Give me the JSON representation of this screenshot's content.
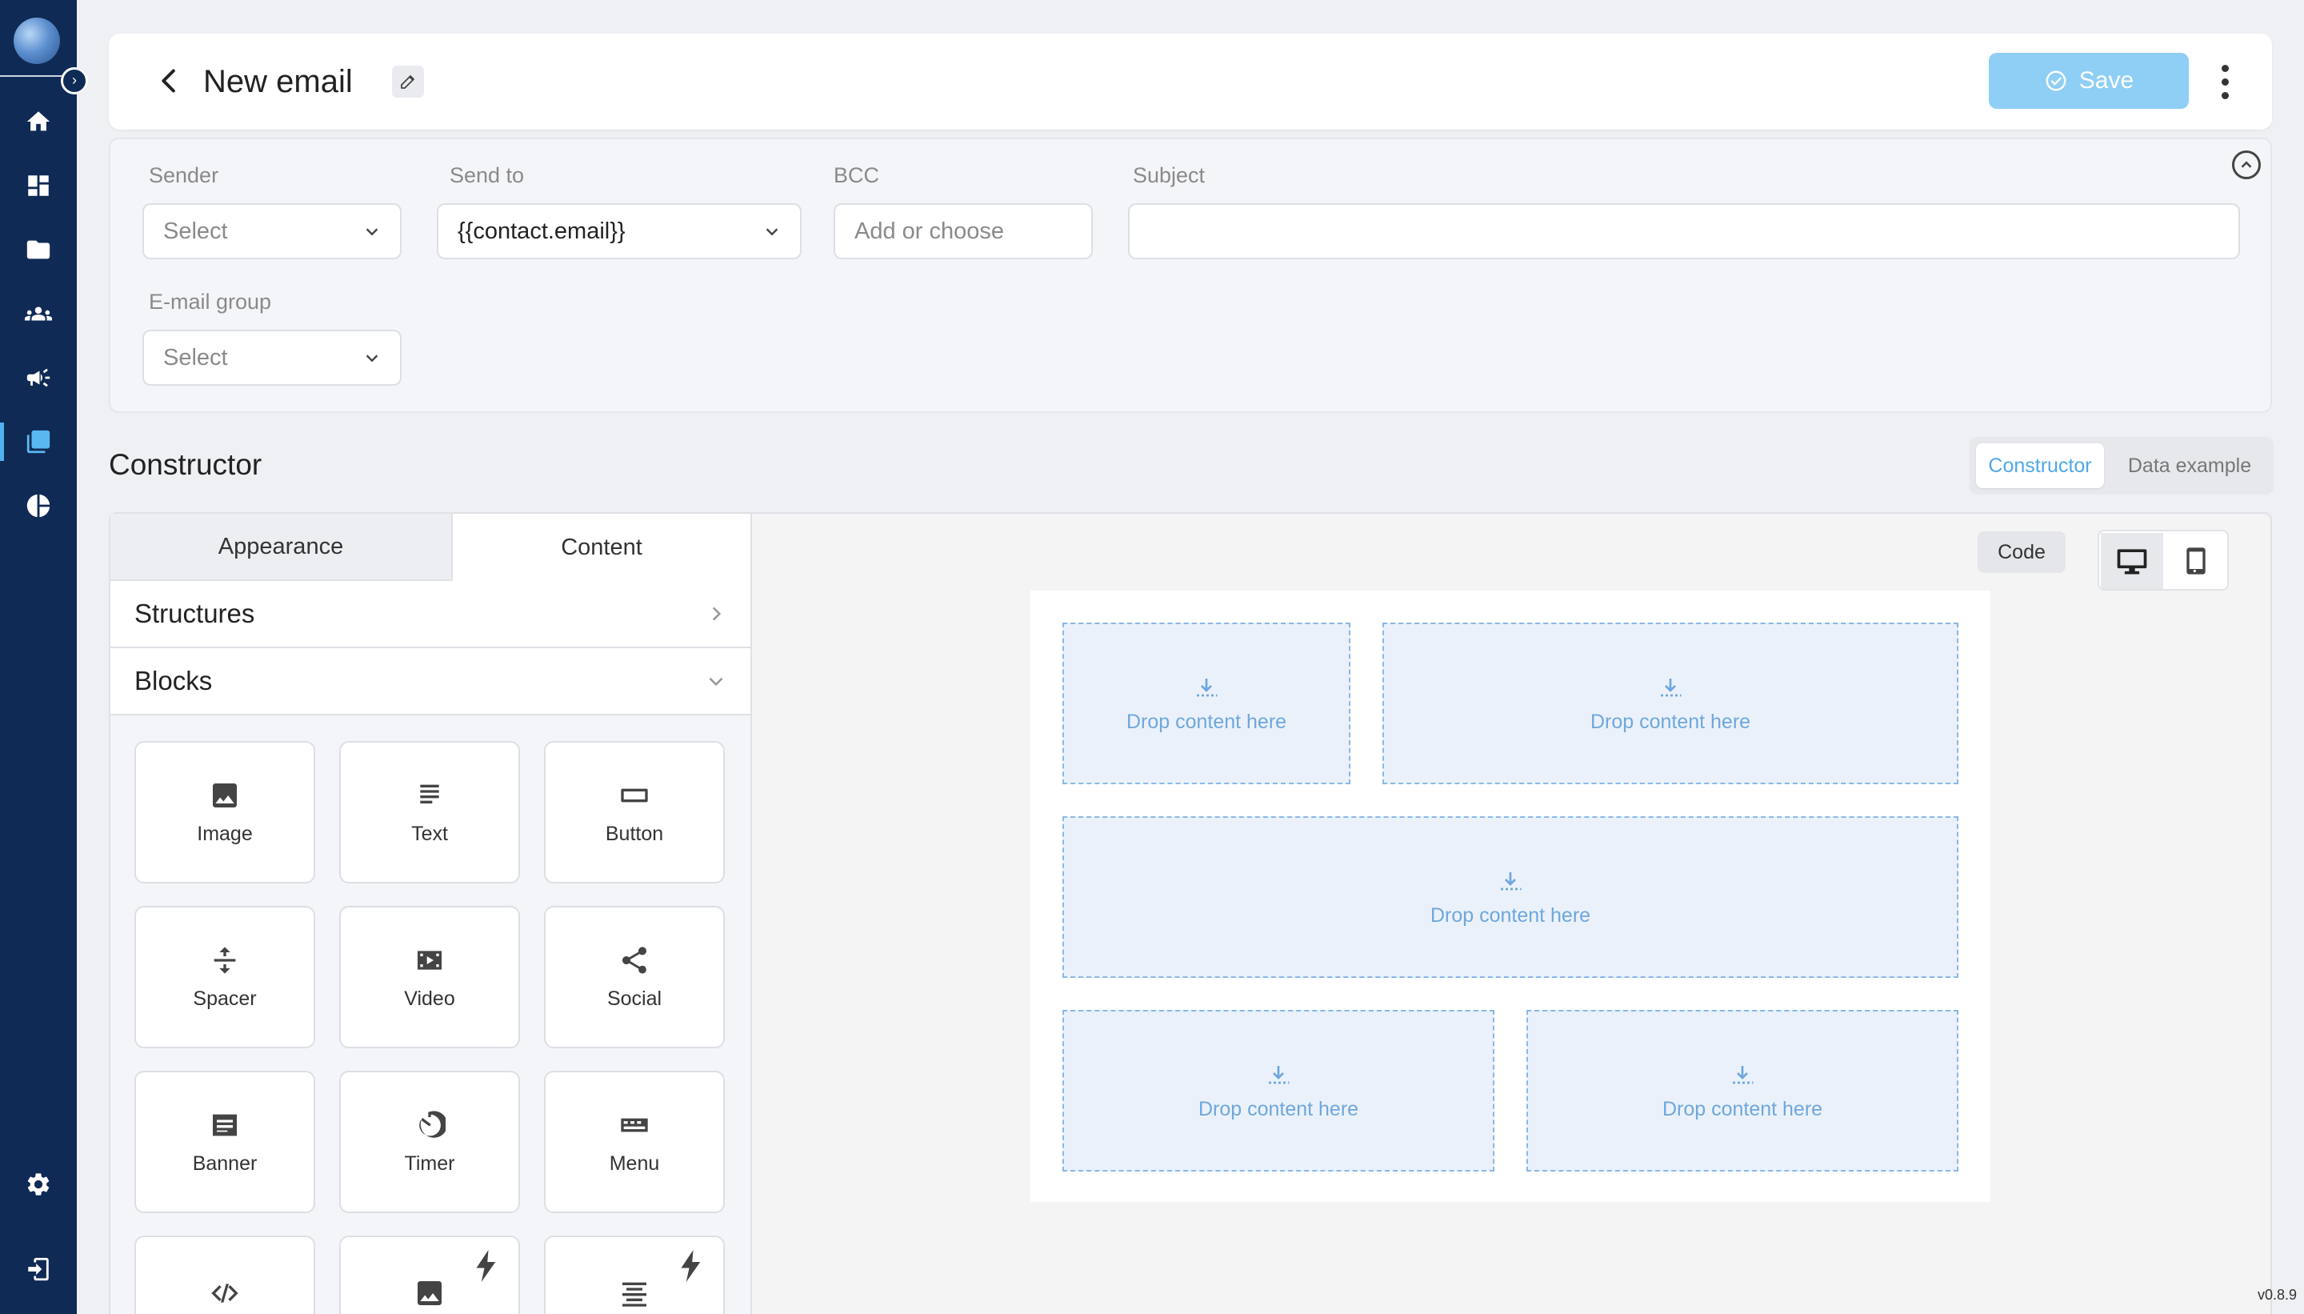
{
  "header": {
    "title": "New email",
    "save_label": "Save"
  },
  "form": {
    "sender": {
      "label": "Sender",
      "placeholder": "Select"
    },
    "send_to": {
      "label": "Send to",
      "value": "{{contact.email}}"
    },
    "bcc": {
      "label": "BCC",
      "placeholder": "Add or choose"
    },
    "subject": {
      "label": "Subject",
      "value": ""
    },
    "email_group": {
      "label": "E-mail group",
      "placeholder": "Select"
    }
  },
  "constructor": {
    "title": "Constructor",
    "view_tabs": [
      "Constructor",
      "Data example"
    ],
    "active_view": "Constructor",
    "panel_tabs": [
      "Appearance",
      "Content"
    ],
    "active_panel_tab": "Content",
    "sections": [
      "Structures",
      "Blocks"
    ],
    "blocks": [
      "Image",
      "Text",
      "Button",
      "Spacer",
      "Video",
      "Social",
      "Banner",
      "Timer",
      "Menu"
    ],
    "code_label": "Code",
    "drop_label": "Drop content here"
  },
  "colors": {
    "sidebar": "#0f2a55",
    "accent": "#4fa8e8",
    "save_button": "#8fcef5",
    "dropzone_border": "#8ab8e6"
  },
  "version": "v0.8.9"
}
